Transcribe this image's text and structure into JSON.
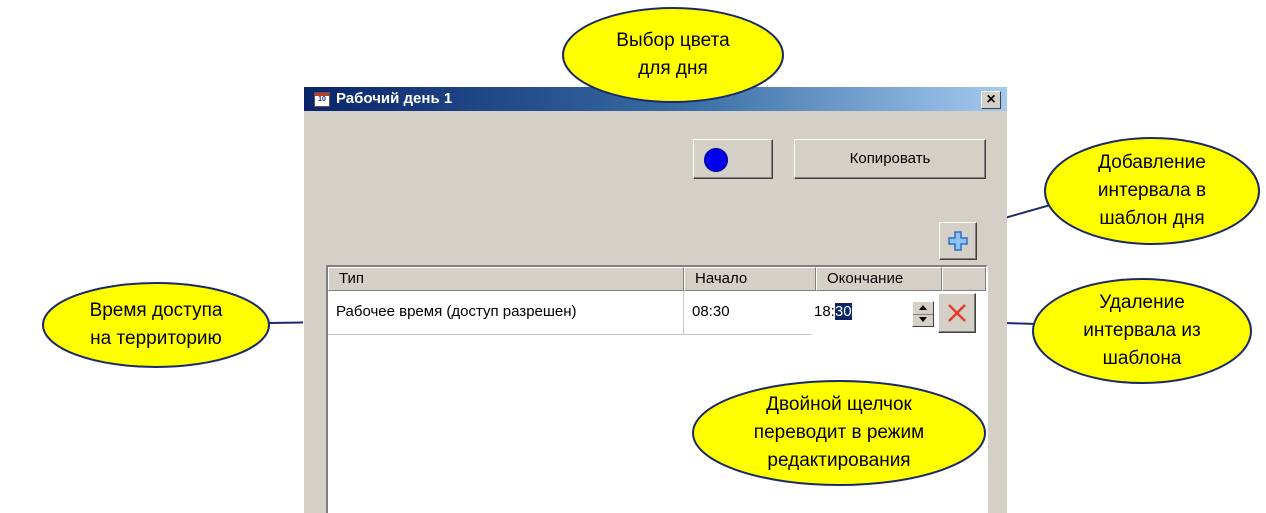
{
  "window": {
    "title": "Рабочий день 1",
    "app_icon_text": "10",
    "close": "×"
  },
  "toolbar": {
    "copy_label": "Копировать",
    "day_color": "#0000ee"
  },
  "table": {
    "headers": [
      "Тип",
      "Начало",
      "Окончание"
    ],
    "row": {
      "type": "Рабочее время (доступ разрешен)",
      "start": "08:30",
      "end_hours": "18:",
      "end_minutes_selected": "30"
    }
  },
  "callouts": {
    "color": [
      "Выбор цвета",
      "для дня"
    ],
    "add": [
      "Добавление",
      "интервала в",
      "шаблон дня"
    ],
    "access": [
      "Время доступа",
      "на территорию"
    ],
    "delete": [
      "Удаление",
      "интервала из",
      "шаблона"
    ],
    "edit": [
      "Двойной щелчок",
      "переводит в режим",
      "редактирования"
    ]
  }
}
